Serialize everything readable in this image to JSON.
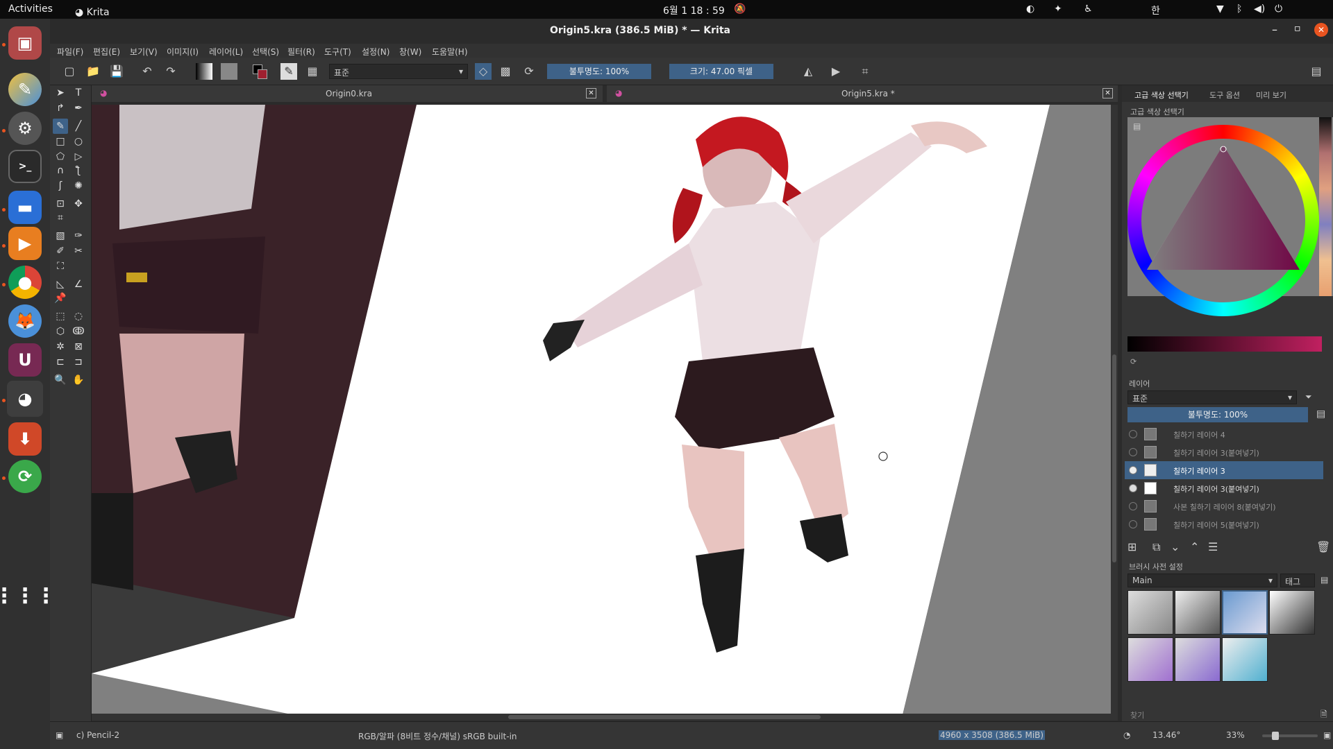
{
  "topbar": {
    "activities": "Activities",
    "app": "Krita",
    "clock": "6월 1  18 : 59",
    "ime": "한"
  },
  "window": {
    "title": "Origin5.kra (386.5 MiB)  * — Krita"
  },
  "menu": [
    "파일(F)",
    "편집(E)",
    "보기(V)",
    "이미지(I)",
    "레이어(L)",
    "선택(S)",
    "필터(R)",
    "도구(T)",
    "설정(N)",
    "창(W)",
    "도움말(H)"
  ],
  "toolbar": {
    "blend_mode": "표준",
    "opacity_label": "불투명도: 100%",
    "size_label": "크기: 47.00 픽셀"
  },
  "documents": [
    {
      "name": "Origin0.kra"
    },
    {
      "name": "Origin5.kra *"
    }
  ],
  "dockers": {
    "tabs": [
      "고급 색상 선택기",
      "도구 옵션",
      "미리 보기"
    ],
    "color_title": "고급 색상 선택기",
    "layers_title": "레이어",
    "layer_blend": "표준",
    "layer_opacity": "불투명도:  100%",
    "layers": [
      {
        "name": "칠하기 레이어 4",
        "visible": false,
        "active": false
      },
      {
        "name": "칠하기 레이어 3(붙여넣기)",
        "visible": false,
        "active": false
      },
      {
        "name": "칠하기 레이어 3",
        "visible": true,
        "active": true
      },
      {
        "name": "칠하기 레이어 3(붙여넣기)",
        "visible": true,
        "active": false
      },
      {
        "name": "사본 칠하기 레이어 8(붙여넣기)",
        "visible": false,
        "active": false
      },
      {
        "name": "칠하기 레이어 5(붙여넣기)",
        "visible": false,
        "active": false
      }
    ],
    "brush_title": "브러시 사전 설정",
    "brush_group": "Main",
    "brush_tag": "태그",
    "search_placeholder": "찾기"
  },
  "status": {
    "brush": "c) Pencil-2",
    "color_space": "RGB/알파 (8비트 정수/채널)  sRGB built-in",
    "dimensions": "4960 x 3508 (386.5 MiB)",
    "rotation": "13.46°",
    "zoom": "33%"
  },
  "colors": {
    "accent": "#3e6288",
    "ubuntu_orange": "#e95420"
  }
}
